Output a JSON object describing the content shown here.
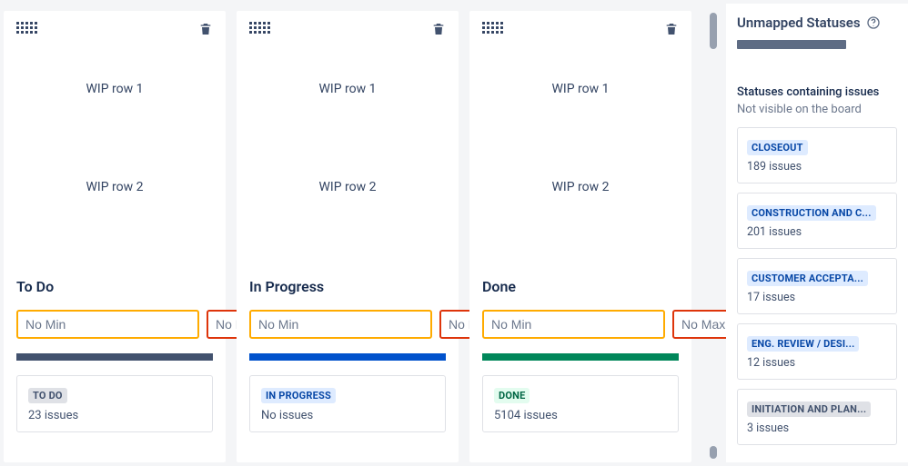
{
  "columns": [
    {
      "wip1": "WIP row 1",
      "wip2": "WIP row 2",
      "title": "To Do",
      "min_ph": "No Min",
      "max_ph": "No Max",
      "accent": "#42526e",
      "status_label": "TO DO",
      "status_class": "lozenge-gray",
      "issues": "23 issues"
    },
    {
      "wip1": "WIP row 1",
      "wip2": "WIP row 2",
      "title": "In Progress",
      "min_ph": "No Min",
      "max_ph": "No Max",
      "accent": "#0052cc",
      "status_label": "IN PROGRESS",
      "status_class": "lozenge-blue",
      "issues": "No issues"
    },
    {
      "wip1": "WIP row 1",
      "wip2": "WIP row 2",
      "title": "Done",
      "min_ph": "No Min",
      "max_ph": "No Max",
      "accent": "#00875a",
      "status_label": "DONE",
      "status_class": "lozenge-green",
      "issues": "5104 issues"
    }
  ],
  "side": {
    "title": "Unmapped Statuses",
    "sub1": "Statuses containing issues",
    "sub2": "Not visible on the board",
    "items": [
      {
        "label": "CLOSEOUT",
        "class": "lozenge-blue",
        "issues": "189 issues"
      },
      {
        "label": "CONSTRUCTION AND C...",
        "class": "lozenge-blue",
        "issues": "201 issues"
      },
      {
        "label": "CUSTOMER ACCEPTA...",
        "class": "lozenge-blue",
        "issues": "17 issues"
      },
      {
        "label": "ENG. REVIEW / DESI...",
        "class": "lozenge-blue",
        "issues": "12 issues"
      },
      {
        "label": "INITIATION AND PLAN...",
        "class": "lozenge-gray",
        "issues": "3 issues"
      }
    ]
  }
}
